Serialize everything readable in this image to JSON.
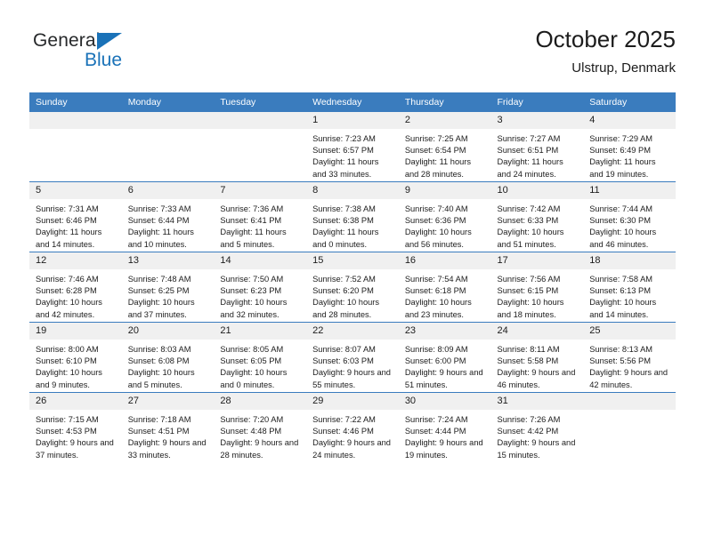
{
  "brand": {
    "name_top": "General",
    "name_bottom": "Blue",
    "accent_color": "#1a72b8"
  },
  "header": {
    "title": "October 2025",
    "subtitle": "Ulstrup, Denmark"
  },
  "calendar": {
    "header_color": "#3a7cbe",
    "daynum_bg": "#f0f0f0",
    "weekday_headers": [
      "Sunday",
      "Monday",
      "Tuesday",
      "Wednesday",
      "Thursday",
      "Friday",
      "Saturday"
    ],
    "labels": {
      "sunrise": "Sunrise:",
      "sunset": "Sunset:",
      "daylight": "Daylight:"
    },
    "weeks": [
      [
        {
          "day": "",
          "blank": true
        },
        {
          "day": "",
          "blank": true
        },
        {
          "day": "",
          "blank": true
        },
        {
          "day": "1",
          "sunrise": "Sunrise: 7:23 AM",
          "sunset": "Sunset: 6:57 PM",
          "daylight": "Daylight: 11 hours and 33 minutes."
        },
        {
          "day": "2",
          "sunrise": "Sunrise: 7:25 AM",
          "sunset": "Sunset: 6:54 PM",
          "daylight": "Daylight: 11 hours and 28 minutes."
        },
        {
          "day": "3",
          "sunrise": "Sunrise: 7:27 AM",
          "sunset": "Sunset: 6:51 PM",
          "daylight": "Daylight: 11 hours and 24 minutes."
        },
        {
          "day": "4",
          "sunrise": "Sunrise: 7:29 AM",
          "sunset": "Sunset: 6:49 PM",
          "daylight": "Daylight: 11 hours and 19 minutes."
        }
      ],
      [
        {
          "day": "5",
          "sunrise": "Sunrise: 7:31 AM",
          "sunset": "Sunset: 6:46 PM",
          "daylight": "Daylight: 11 hours and 14 minutes."
        },
        {
          "day": "6",
          "sunrise": "Sunrise: 7:33 AM",
          "sunset": "Sunset: 6:44 PM",
          "daylight": "Daylight: 11 hours and 10 minutes."
        },
        {
          "day": "7",
          "sunrise": "Sunrise: 7:36 AM",
          "sunset": "Sunset: 6:41 PM",
          "daylight": "Daylight: 11 hours and 5 minutes."
        },
        {
          "day": "8",
          "sunrise": "Sunrise: 7:38 AM",
          "sunset": "Sunset: 6:38 PM",
          "daylight": "Daylight: 11 hours and 0 minutes."
        },
        {
          "day": "9",
          "sunrise": "Sunrise: 7:40 AM",
          "sunset": "Sunset: 6:36 PM",
          "daylight": "Daylight: 10 hours and 56 minutes."
        },
        {
          "day": "10",
          "sunrise": "Sunrise: 7:42 AM",
          "sunset": "Sunset: 6:33 PM",
          "daylight": "Daylight: 10 hours and 51 minutes."
        },
        {
          "day": "11",
          "sunrise": "Sunrise: 7:44 AM",
          "sunset": "Sunset: 6:30 PM",
          "daylight": "Daylight: 10 hours and 46 minutes."
        }
      ],
      [
        {
          "day": "12",
          "sunrise": "Sunrise: 7:46 AM",
          "sunset": "Sunset: 6:28 PM",
          "daylight": "Daylight: 10 hours and 42 minutes."
        },
        {
          "day": "13",
          "sunrise": "Sunrise: 7:48 AM",
          "sunset": "Sunset: 6:25 PM",
          "daylight": "Daylight: 10 hours and 37 minutes."
        },
        {
          "day": "14",
          "sunrise": "Sunrise: 7:50 AM",
          "sunset": "Sunset: 6:23 PM",
          "daylight": "Daylight: 10 hours and 32 minutes."
        },
        {
          "day": "15",
          "sunrise": "Sunrise: 7:52 AM",
          "sunset": "Sunset: 6:20 PM",
          "daylight": "Daylight: 10 hours and 28 minutes."
        },
        {
          "day": "16",
          "sunrise": "Sunrise: 7:54 AM",
          "sunset": "Sunset: 6:18 PM",
          "daylight": "Daylight: 10 hours and 23 minutes."
        },
        {
          "day": "17",
          "sunrise": "Sunrise: 7:56 AM",
          "sunset": "Sunset: 6:15 PM",
          "daylight": "Daylight: 10 hours and 18 minutes."
        },
        {
          "day": "18",
          "sunrise": "Sunrise: 7:58 AM",
          "sunset": "Sunset: 6:13 PM",
          "daylight": "Daylight: 10 hours and 14 minutes."
        }
      ],
      [
        {
          "day": "19",
          "sunrise": "Sunrise: 8:00 AM",
          "sunset": "Sunset: 6:10 PM",
          "daylight": "Daylight: 10 hours and 9 minutes."
        },
        {
          "day": "20",
          "sunrise": "Sunrise: 8:03 AM",
          "sunset": "Sunset: 6:08 PM",
          "daylight": "Daylight: 10 hours and 5 minutes."
        },
        {
          "day": "21",
          "sunrise": "Sunrise: 8:05 AM",
          "sunset": "Sunset: 6:05 PM",
          "daylight": "Daylight: 10 hours and 0 minutes."
        },
        {
          "day": "22",
          "sunrise": "Sunrise: 8:07 AM",
          "sunset": "Sunset: 6:03 PM",
          "daylight": "Daylight: 9 hours and 55 minutes."
        },
        {
          "day": "23",
          "sunrise": "Sunrise: 8:09 AM",
          "sunset": "Sunset: 6:00 PM",
          "daylight": "Daylight: 9 hours and 51 minutes."
        },
        {
          "day": "24",
          "sunrise": "Sunrise: 8:11 AM",
          "sunset": "Sunset: 5:58 PM",
          "daylight": "Daylight: 9 hours and 46 minutes."
        },
        {
          "day": "25",
          "sunrise": "Sunrise: 8:13 AM",
          "sunset": "Sunset: 5:56 PM",
          "daylight": "Daylight: 9 hours and 42 minutes."
        }
      ],
      [
        {
          "day": "26",
          "sunrise": "Sunrise: 7:15 AM",
          "sunset": "Sunset: 4:53 PM",
          "daylight": "Daylight: 9 hours and 37 minutes."
        },
        {
          "day": "27",
          "sunrise": "Sunrise: 7:18 AM",
          "sunset": "Sunset: 4:51 PM",
          "daylight": "Daylight: 9 hours and 33 minutes."
        },
        {
          "day": "28",
          "sunrise": "Sunrise: 7:20 AM",
          "sunset": "Sunset: 4:48 PM",
          "daylight": "Daylight: 9 hours and 28 minutes."
        },
        {
          "day": "29",
          "sunrise": "Sunrise: 7:22 AM",
          "sunset": "Sunset: 4:46 PM",
          "daylight": "Daylight: 9 hours and 24 minutes."
        },
        {
          "day": "30",
          "sunrise": "Sunrise: 7:24 AM",
          "sunset": "Sunset: 4:44 PM",
          "daylight": "Daylight: 9 hours and 19 minutes."
        },
        {
          "day": "31",
          "sunrise": "Sunrise: 7:26 AM",
          "sunset": "Sunset: 4:42 PM",
          "daylight": "Daylight: 9 hours and 15 minutes."
        },
        {
          "day": "",
          "blank": true
        }
      ]
    ]
  }
}
